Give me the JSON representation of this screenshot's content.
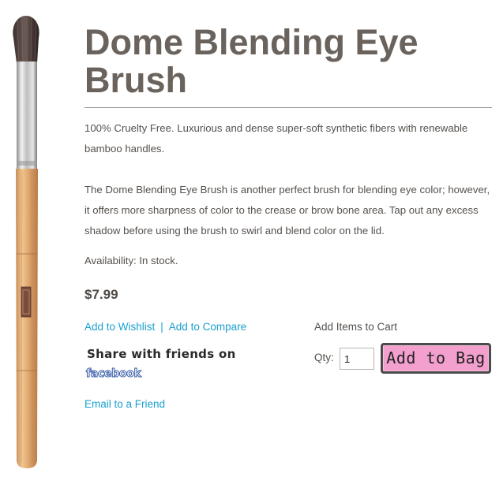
{
  "product": {
    "title": "Dome Blending Eye Brush",
    "description_short": "100% Cruelty Free. Luxurious and dense super-soft synthetic fibers with renewable bamboo handles.",
    "description_long": "The Dome Blending Eye Brush is another perfect brush for blending eye color; however, it offers more sharpness of color to the crease or brow bone area. Tap out any excess shadow before using the brush to swirl and blend color on the lid.",
    "availability": "Availability: In stock.",
    "price": "$7.99",
    "image_icon": "makeup-brush-image"
  },
  "links": {
    "wishlist": "Add to Wishlist",
    "separator": "|",
    "compare": "Add to Compare",
    "email": "Email to a Friend"
  },
  "share": {
    "label": "Share with friends on",
    "network": "facebook"
  },
  "cart": {
    "heading": "Add Items to Cart",
    "qty_label": "Qty:",
    "qty_value": "1",
    "button_label": "Add to Bag"
  },
  "colors": {
    "title": "#6a625c",
    "link": "#1aa0cf",
    "button_bg": "#f3a0cf",
    "facebook": "#3b5ea8"
  }
}
